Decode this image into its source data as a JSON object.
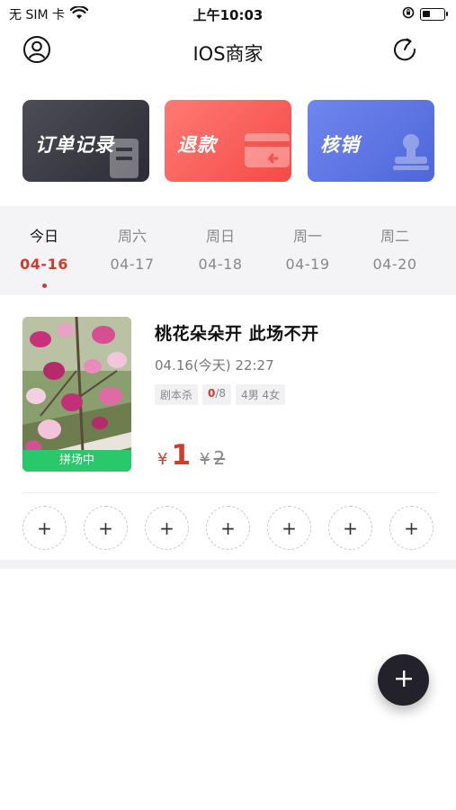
{
  "status_bar": {
    "carrier": "无 SIM 卡",
    "time": "上午10:03",
    "icons": [
      "wifi-icon",
      "orientation-lock-icon",
      "battery-icon"
    ],
    "battery_level": 0.35
  },
  "nav": {
    "title": "IOS商家",
    "left_icon": "user-profile-icon",
    "right_icon": "refresh-icon"
  },
  "actions": [
    {
      "label": "订单记录",
      "icon": "receipt-icon",
      "color": "#3a3a44"
    },
    {
      "label": "退款",
      "icon": "card-return-icon",
      "color": "#f75d59"
    },
    {
      "label": "核销",
      "icon": "stamp-icon",
      "color": "#5b72e2"
    }
  ],
  "days": [
    {
      "name": "今日",
      "date": "04-16",
      "active": true
    },
    {
      "name": "周六",
      "date": "04-17",
      "active": false
    },
    {
      "name": "周日",
      "date": "04-18",
      "active": false
    },
    {
      "name": "周一",
      "date": "04-19",
      "active": false
    },
    {
      "name": "周二",
      "date": "04-20",
      "active": false
    }
  ],
  "event": {
    "title": "桃花朵朵开 此场不开",
    "time": "04.16(今天) 22:27",
    "status": "拼场中",
    "tags": {
      "type": "剧本杀",
      "joined": "0",
      "capacity": "/8",
      "gender": "4男 4女"
    },
    "price_symbol": "¥",
    "price": "1",
    "original_symbol": "¥",
    "original_price": "2"
  },
  "seats": {
    "count": 7,
    "symbol": "+"
  },
  "fab": {
    "symbol": "+"
  },
  "colors": {
    "accent_red": "#d23a2c",
    "status_green": "#29c86a",
    "fab_dark": "#23222b"
  }
}
